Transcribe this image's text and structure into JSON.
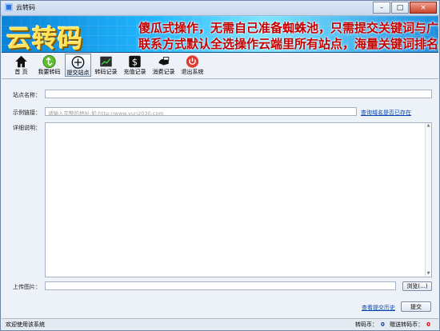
{
  "window": {
    "title": "云转码"
  },
  "banner": {
    "logo": "云转码",
    "line1": "傻瓜式操作，无需自己准备蜘蛛池，只需提交关键词与广告",
    "line2": "联系方式默认全选操作云端里所有站点，海量关键词排名首页！"
  },
  "toolbar": {
    "items": [
      {
        "label": "首 页",
        "icon": "home-icon"
      },
      {
        "label": "我要转码",
        "icon": "recycle-icon"
      },
      {
        "label": "提交站点",
        "icon": "add-site-icon"
      },
      {
        "label": "转码记录",
        "icon": "chart-icon"
      },
      {
        "label": "充值记录",
        "icon": "dollar-icon"
      },
      {
        "label": "消费记录",
        "icon": "consume-icon"
      },
      {
        "label": "退出系统",
        "icon": "power-icon"
      }
    ]
  },
  "form": {
    "site_name_label": "站点名称：",
    "example_link_label": "示例链接：",
    "example_link_placeholder": "请输入完整的地址,如:http://www.yun2030.com",
    "check_domain_link": "查询域名是否已存在",
    "description_label": "详细说明：",
    "upload_image_label": "上传图片：",
    "browse_button": "浏览(...)",
    "history_link": "查看提交历史",
    "submit_button": "提交"
  },
  "status": {
    "welcome": "欢迎使用该系统",
    "coin_label": "转码币：",
    "coin_value": "0",
    "gift_label": "赠送转码币：",
    "gift_value": "0"
  }
}
